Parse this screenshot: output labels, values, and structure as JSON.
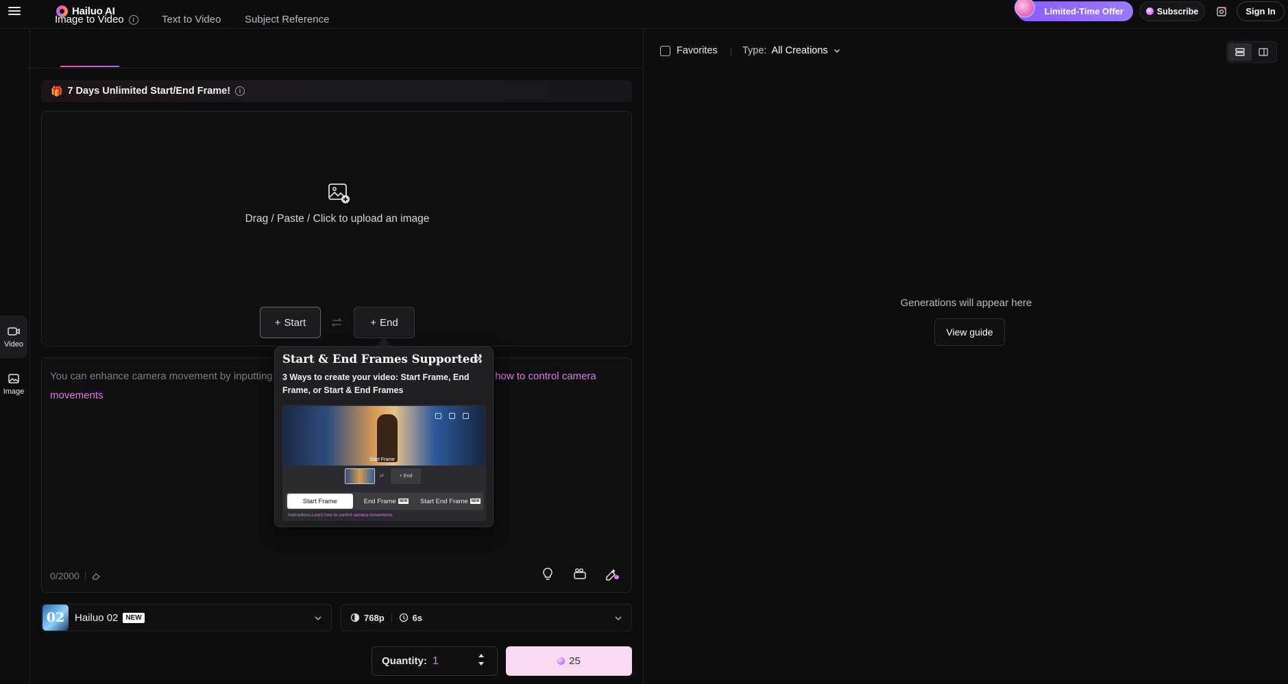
{
  "app": {
    "name": "Hailuo AI"
  },
  "topbar": {
    "offer_label": "Limited-Time Offer",
    "subscribe_label": "Subscribe",
    "signin_label": "Sign In"
  },
  "rail": {
    "items": [
      {
        "label": "Video",
        "icon": "video-icon"
      },
      {
        "label": "Image",
        "icon": "image-icon"
      }
    ]
  },
  "tabs": [
    {
      "label": "Image to Video",
      "active": true
    },
    {
      "label": "Text to Video",
      "active": false
    },
    {
      "label": "Subject Reference",
      "active": false
    }
  ],
  "promo": {
    "text": "7 Days Unlimited Start/End Frame!"
  },
  "upload": {
    "text": "Drag / Paste / Click to upload an image",
    "start_label": "Start",
    "end_label": "End"
  },
  "prompt": {
    "placeholder": "You can enhance camera movement by inputting",
    "link_partial": "Learn how to control camera",
    "link_rest": "movements",
    "char_count": "0/2000"
  },
  "model": {
    "thumb_text": "02",
    "name": "Hailuo 02",
    "badge": "NEW"
  },
  "settings": {
    "resolution": "768p",
    "duration": "6s"
  },
  "quantity": {
    "label": "Quantity:",
    "value": "1"
  },
  "generate": {
    "cost": "25"
  },
  "popover": {
    "title": "Start & End Frames Supported!",
    "description": "3 Ways to create your video: Start Frame, End Frame, or Start & End Frames",
    "preview": {
      "caption": "Start Frame",
      "end_label": "+ End",
      "tabs": [
        {
          "label": "Start Frame",
          "badge": ""
        },
        {
          "label": "End Frame",
          "badge": "NEW"
        },
        {
          "label": "Start End Frame",
          "badge": "NEW"
        }
      ],
      "instr_prefix": "instructions.",
      "instr_link": "Learn how to control camera movements"
    }
  },
  "gallery": {
    "favorites_label": "Favorites",
    "type_label": "Type:",
    "type_value": "All Creations",
    "empty_message": "Generations will appear here",
    "guide_label": "View guide"
  },
  "colors": {
    "accent_pink": "#e07ae8",
    "offer_purple": "#8a5cff",
    "generate_bg": "#f7d9f2"
  }
}
